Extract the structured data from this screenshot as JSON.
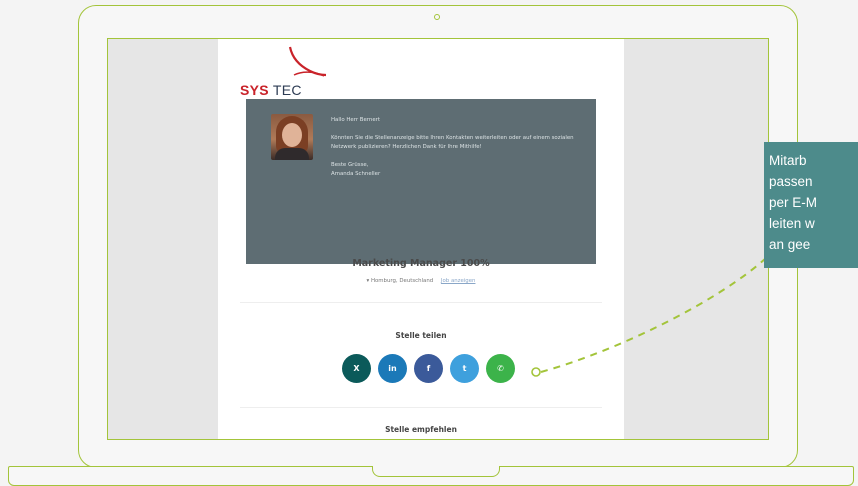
{
  "brand": {
    "sys": "SYS",
    "tec": "TEC",
    "accent": "#c9232a"
  },
  "contact": {
    "greeting": "Hallo Herr Bernert",
    "message": "Könnten Sie die Stellenanzeige bitte Ihren Kontakten weiterleiten oder auf einem sozialen Netzwerk publizieren? Herzlichen Dank für Ihre Mithilfe!",
    "closing": "Beste Grüsse,",
    "signature": "Amanda Schneller"
  },
  "job": {
    "title": "Marketing Manager 100%",
    "location": "Homburg, Deutschland",
    "details_link": "Job anzeigen"
  },
  "share": {
    "title": "Stelle teilen",
    "buttons": [
      {
        "label": "X",
        "icon": "xing-icon",
        "color": "#0b5a5a"
      },
      {
        "label": "in",
        "icon": "linkedin-icon",
        "color": "#1b79b8"
      },
      {
        "label": "f",
        "icon": "facebook-icon",
        "color": "#3b5a9a"
      },
      {
        "label": "t",
        "icon": "twitter-icon",
        "color": "#3ea0dd"
      },
      {
        "label": "✆",
        "icon": "whatsapp-icon",
        "color": "#3cb34a"
      }
    ]
  },
  "recommend": {
    "title": "Stelle empfehlen"
  },
  "callout": {
    "lines": [
      "Mitarb",
      "passen",
      "per E-M",
      "leiten w",
      "an gee"
    ],
    "color": "#4d8b8b",
    "line_color": "#a3c43a"
  }
}
